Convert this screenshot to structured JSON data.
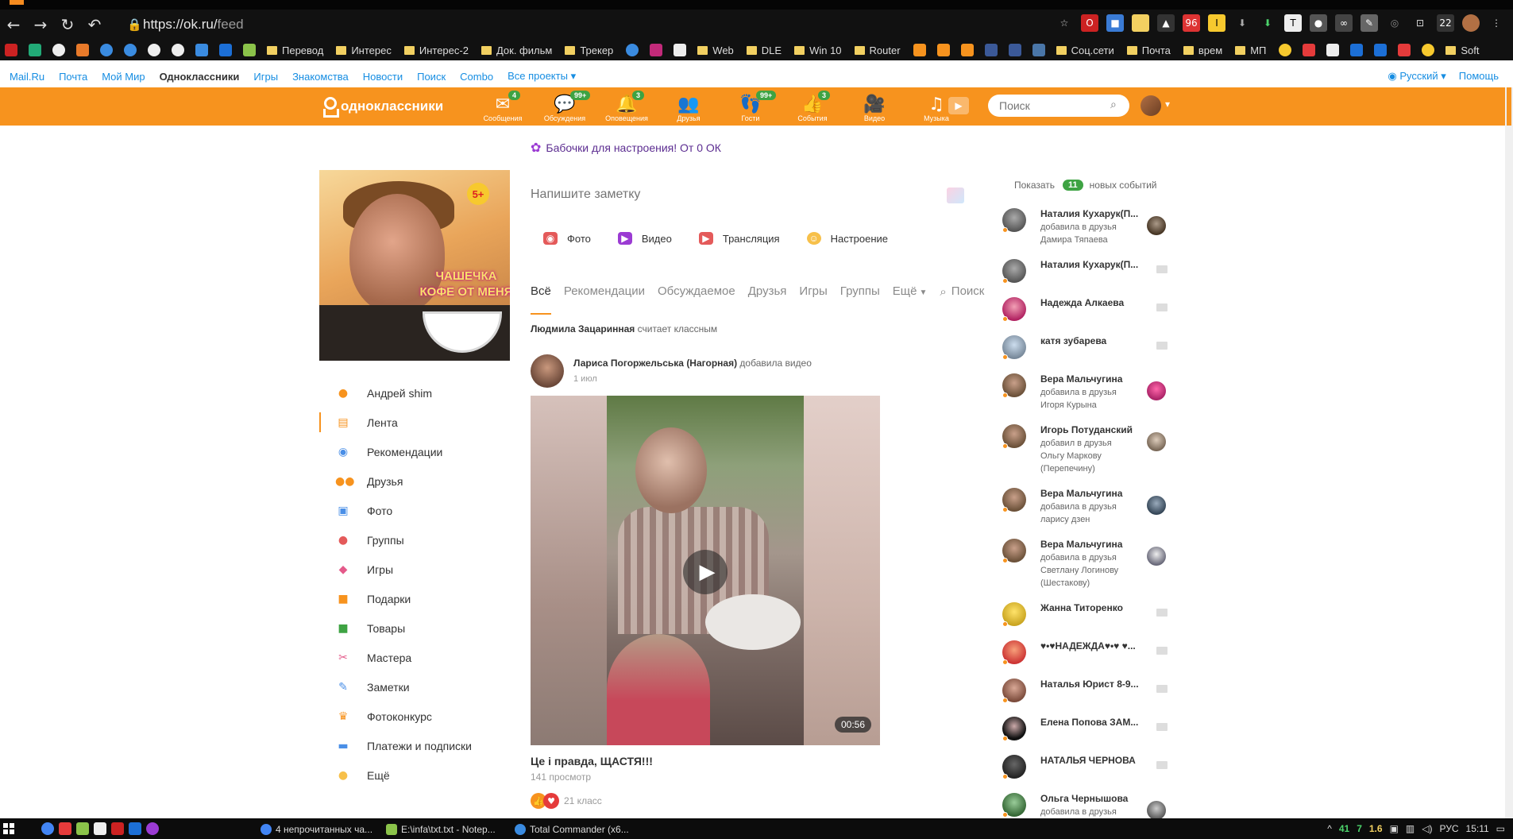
{
  "browser": {
    "url_host": "https://ok.ru/",
    "url_path": "feed",
    "bookmarks": [
      "Перевод",
      "Интерес",
      "Интерес-2",
      "Док. фильм",
      "Трекер",
      "Web",
      "DLE",
      "Win 10",
      "Router",
      "Соц.сети",
      "Почта",
      "врем",
      "МП",
      "Soft"
    ]
  },
  "mailru": {
    "links": [
      "Mail.Ru",
      "Почта",
      "Мой Мир",
      "Одноклассники",
      "Игры",
      "Знакомства",
      "Новости",
      "Поиск",
      "Combo",
      "Все проекты"
    ],
    "language": "Русский",
    "help": "Помощь"
  },
  "ok_header": {
    "logo": "одноклассники",
    "nav": [
      {
        "label": "Сообщения",
        "badge": "4",
        "icon": "envelope-icon"
      },
      {
        "label": "Обсуждения",
        "badge": "99+",
        "icon": "speech-bubbles-icon"
      },
      {
        "label": "Оповещения",
        "badge": "3",
        "icon": "bell-icon"
      },
      {
        "label": "Друзья",
        "badge": "",
        "icon": "people-icon"
      },
      {
        "label": "Гости",
        "badge": "99+",
        "icon": "footprints-icon"
      },
      {
        "label": "События",
        "badge": "3",
        "icon": "thumbs-up-icon"
      },
      {
        "label": "Видео",
        "badge": "",
        "icon": "video-camera-icon"
      },
      {
        "label": "Музыка",
        "badge": "",
        "icon": "music-note-icon"
      }
    ],
    "search_placeholder": "Поиск"
  },
  "promo": "Бабочки для настроения! От 0 ОК",
  "profile": {
    "age_badge": "5+",
    "photo_caption": "ЧАШЕЧКА КОФЕ ОТ МЕНЯ",
    "menu": [
      {
        "label": "Андрей shim",
        "icon": "person-icon",
        "color": "#f7931e"
      },
      {
        "label": "Лента",
        "icon": "feed-icon",
        "color": "#f7931e",
        "active": true
      },
      {
        "label": "Рекомендации",
        "icon": "compass-icon",
        "color": "#4a8fe7"
      },
      {
        "label": "Друзья",
        "icon": "friends-icon",
        "color": "#f7931e"
      },
      {
        "label": "Фото",
        "icon": "photo-icon",
        "color": "#4a8fe7"
      },
      {
        "label": "Группы",
        "icon": "groups-icon",
        "color": "#e45a5a"
      },
      {
        "label": "Игры",
        "icon": "gamepad-icon",
        "color": "#e45a8a"
      },
      {
        "label": "Подарки",
        "icon": "gift-icon",
        "color": "#f7931e"
      },
      {
        "label": "Товары",
        "icon": "shopping-bag-icon",
        "color": "#3ea343"
      },
      {
        "label": "Мастера",
        "icon": "tools-icon",
        "color": "#e45a8a"
      },
      {
        "label": "Заметки",
        "icon": "pencil-icon",
        "color": "#4a8fe7"
      },
      {
        "label": "Фотоконкурс",
        "icon": "trophy-icon",
        "color": "#f7931e"
      },
      {
        "label": "Платежи и подписки",
        "icon": "wallet-icon",
        "color": "#4a8fe7"
      },
      {
        "label": "Ещё",
        "icon": "more-icon",
        "color": "#f7c04a"
      }
    ]
  },
  "feed": {
    "note_placeholder": "Напишите заметку",
    "actions": [
      {
        "label": "Фото",
        "color": "#e45a5a"
      },
      {
        "label": "Видео",
        "color": "#9b3bd3"
      },
      {
        "label": "Трансляция",
        "color": "#e45a5a"
      },
      {
        "label": "Настроение",
        "color": "#f7c04a"
      }
    ],
    "tabs": [
      "Всё",
      "Рекомендации",
      "Обсуждаемое",
      "Друзья",
      "Игры",
      "Группы",
      "Ещё",
      "Поиск"
    ],
    "liker_name": "Людмила Зацаринная",
    "liker_text": "считает классным",
    "post": {
      "author": "Лариса Погоржельська (Нагорная)",
      "action": "добавила видео",
      "date": "1 июл",
      "duration": "00:56",
      "title": "Це і правда, ЩАСТЯ!!!",
      "views": "141 просмотр",
      "klass": "21 класс"
    }
  },
  "events": {
    "show": "Показать",
    "count": "11",
    "suffix": "новых событий",
    "friends": [
      {
        "name": "Наталия Кухарук(П...",
        "sub": "добавила в друзья Дамира Тяпаева",
        "mini": true
      },
      {
        "name": "Наталия Кухарук(П...",
        "sub": "",
        "mini": false
      },
      {
        "name": "Надежда Алкаева",
        "sub": "",
        "mini": false
      },
      {
        "name": "катя зубарева",
        "sub": "",
        "mini": false
      },
      {
        "name": "Вера Мальчугина",
        "sub": "добавила в друзья Игоря Курына",
        "mini": true
      },
      {
        "name": "Игорь Потуданский",
        "sub": "добавил в друзья Ольгу Маркову (Перепечину)",
        "mini": true
      },
      {
        "name": "Вера Мальчугина",
        "sub": "добавила в друзья ларису дзен",
        "mini": true
      },
      {
        "name": "Вера Мальчугина",
        "sub": "добавила в друзья Светлану Логинову (Шестакову)",
        "mini": true
      },
      {
        "name": "Жанна Титоренко",
        "sub": "",
        "mini": false
      },
      {
        "name": "♥•♥НАДЕЖДА♥•♥ ♥...",
        "sub": "",
        "mini": false
      },
      {
        "name": "Наталья Юрист 8-9...",
        "sub": "",
        "mini": false
      },
      {
        "name": "Елена Попова ЗАМ...",
        "sub": "",
        "mini": false
      },
      {
        "name": "НАТАЛЬЯ ЧЕРНОВА",
        "sub": "",
        "mini": false
      },
      {
        "name": "Ольга Чернышова",
        "sub": "добавила в друзья",
        "mini": true
      }
    ]
  },
  "taskbar": {
    "tasks": [
      "4 непрочитанных ча...",
      "E:\\infa\\txt.txt - Notep...",
      "Total Commander (x6..."
    ],
    "tray_values": [
      "41",
      "7",
      "1.6"
    ],
    "lang": "РУС",
    "time": "15:11"
  },
  "colors": {
    "ok_orange": "#f7931e",
    "badge_green": "#3ea343",
    "link_blue": "#168de2"
  }
}
